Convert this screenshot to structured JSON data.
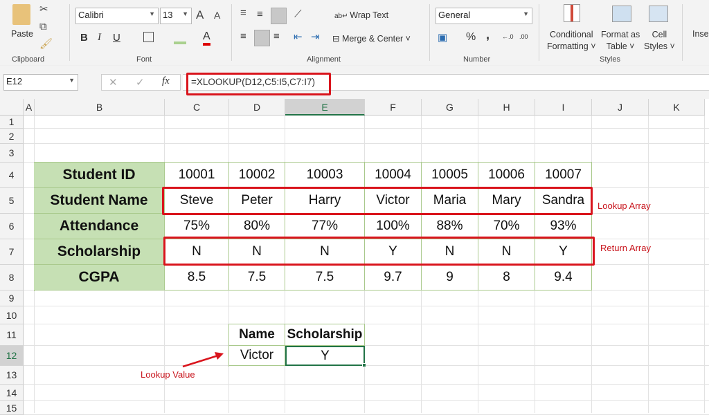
{
  "ribbon": {
    "clipboard": {
      "paste": "Paste",
      "group": "Clipboard"
    },
    "font": {
      "name": "Calibri",
      "size": "13",
      "bold": "B",
      "italic": "I",
      "underline": "U",
      "group": "Font"
    },
    "alignment": {
      "wrap_text": "Wrap Text",
      "merge_center": "Merge & Center",
      "group": "Alignment"
    },
    "number": {
      "format": "General",
      "percent": "%",
      "comma": ",",
      "group": "Number"
    },
    "styles": {
      "conditional": "Conditional",
      "conditional2": "Formatting",
      "format_as": "Format as",
      "format_as2": "Table",
      "cell": "Cell",
      "cell2": "Styles",
      "group": "Styles"
    },
    "insert": "Inse"
  },
  "formula_bar": {
    "name_box": "E12",
    "fx": "fx",
    "formula": "=XLOOKUP(D12,C5:I5,C7:I7)"
  },
  "columns": [
    "A",
    "B",
    "C",
    "D",
    "E",
    "F",
    "G",
    "H",
    "I",
    "J",
    "K"
  ],
  "rows": [
    "1",
    "2",
    "3",
    "4",
    "5",
    "6",
    "7",
    "8",
    "9",
    "10",
    "11",
    "12",
    "13",
    "14",
    "15"
  ],
  "selected_cell": "E12",
  "table": [
    {
      "label": "Student ID",
      "values": [
        "10001",
        "10002",
        "10003",
        "10004",
        "10005",
        "10006",
        "10007"
      ]
    },
    {
      "label": "Student Name",
      "values": [
        "Steve",
        "Peter",
        "Harry",
        "Victor",
        "Maria",
        "Mary",
        "Sandra"
      ]
    },
    {
      "label": "Attendance",
      "values": [
        "75%",
        "80%",
        "77%",
        "100%",
        "88%",
        "70%",
        "93%"
      ]
    },
    {
      "label": "Scholarship",
      "values": [
        "N",
        "N",
        "N",
        "Y",
        "N",
        "N",
        "Y"
      ]
    },
    {
      "label": "CGPA",
      "values": [
        "8.5",
        "7.5",
        "7.5",
        "9.7",
        "9",
        "8",
        "9.4"
      ]
    }
  ],
  "lookup_table": {
    "headers": [
      "Name",
      "Scholarship"
    ],
    "values": [
      "Victor",
      "Y"
    ]
  },
  "annotations": {
    "lookup_array": "Lookup Array",
    "return_array": "Return Array",
    "lookup_value": "Lookup Value"
  },
  "colors": {
    "header_fill": "#c6e0b4",
    "annotation": "#d9141c",
    "selection": "#217346"
  }
}
